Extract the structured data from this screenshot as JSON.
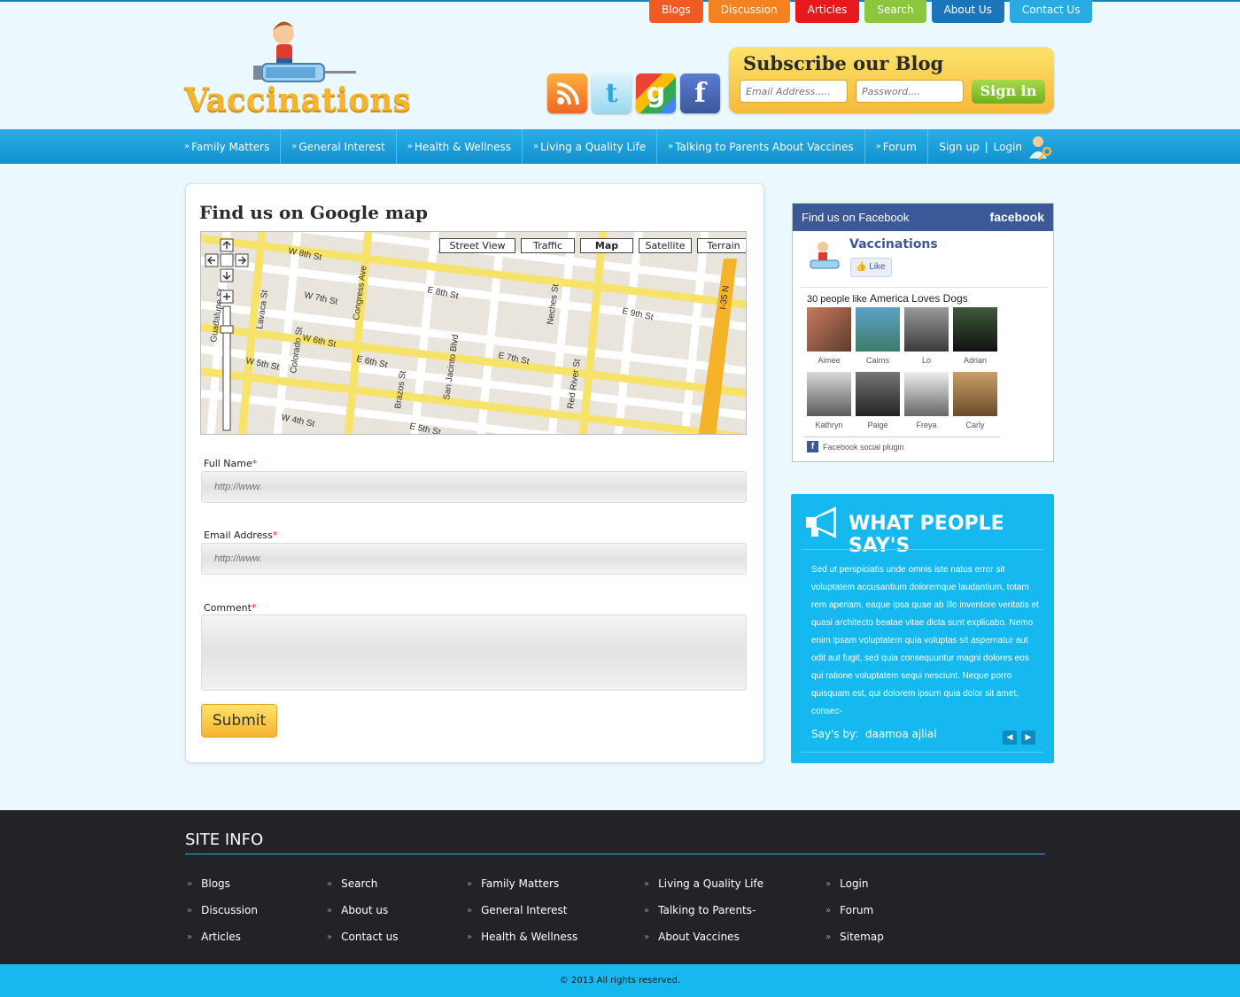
{
  "top_tabs": [
    {
      "label": "Blogs",
      "color": "#f15a24"
    },
    {
      "label": "Discussion",
      "color": "#f58220"
    },
    {
      "label": "Articles",
      "color": "#e8191c"
    },
    {
      "label": "Search",
      "color": "#8cc63f"
    },
    {
      "label": "About Us",
      "color": "#1b75bb"
    },
    {
      "label": "Contact Us",
      "color": "#29abe2"
    }
  ],
  "logo": {
    "text": "Vaccinations"
  },
  "social": [
    {
      "name": "rss",
      "color": "#f7941d"
    },
    {
      "name": "twitter",
      "color": "#48c3ec"
    },
    {
      "name": "google",
      "color": "#34a853"
    },
    {
      "name": "facebook",
      "color": "#3b5998"
    }
  ],
  "subscribe": {
    "title": "Subscribe our Blog",
    "email_placeholder": "Email Address.....",
    "password_placeholder": "Password....",
    "button": "Sign in"
  },
  "nav": {
    "items": [
      "Family Matters",
      "General Interest",
      "Health & Wellness",
      "Living a Quality Life",
      "Talking to Parents About Vaccines",
      "Forum"
    ],
    "signup": "Sign up",
    "separator": "|",
    "login": "Login"
  },
  "main": {
    "title": "Find us on Google map",
    "map_buttons": [
      "Street View",
      "Traffic",
      "Map",
      "Satellite",
      "Terrain"
    ],
    "map_streets": [
      "W 8th St",
      "W 7th St",
      "W 6th St",
      "W 5th St",
      "W 4th St",
      "E 8th St",
      "E 7th St",
      "E 6th St",
      "E 5th St",
      "E 9th St",
      "Congress Ave",
      "Colorado St",
      "Lavaca St",
      "Guadalupe St",
      "Brazos St",
      "San Jacinto Blvd",
      "Red River St",
      "Neches St",
      "I-35 N"
    ],
    "full_name_label": "Full Name",
    "email_label": "Email Address",
    "comment_label": "Comment",
    "required": "*",
    "placeholder": "http://www.",
    "submit": "Submit"
  },
  "facebook": {
    "header": "Find us on Facebook",
    "brand": "facebook",
    "page_name": "Vaccinations",
    "like": "Like",
    "count_text": "30 people like",
    "count_page": "America Loves Dogs",
    "people": [
      "Aimee",
      "Cairns",
      "Lo",
      "Adrian",
      "Kathryn",
      "Paige",
      "Freya",
      "Carly"
    ],
    "plugin": "Facebook social plugin"
  },
  "testimonial": {
    "title": "WHAT PEOPLE SAY'S",
    "text": "Sed ut perspiciatis unde omnis iste natus error sit voluptatem accusantium doloremque laudantium, totam rem aperiam, eaque ipsa quae ab illo inventore veritatis et quasi architecto beatae vitae dicta sunt explicabo. Nemo enim ipsam voluptatem quia voluptas sit aspernatur aut odit aut fugit, sed quia consequuntur magni dolores eos qui ratione voluptatem sequi nesciunt. Neque porro quisquam est, qui dolorem ipsum quia dolor sit amet, consec-",
    "by_label": "Say's by:",
    "by_name": "daamoa ajlial"
  },
  "footer": {
    "title": "SITE INFO",
    "columns": [
      [
        "Blogs",
        "Discussion",
        "Articles"
      ],
      [
        "Search",
        "About us",
        "Contact us"
      ],
      [
        "Family Matters",
        "General Interest",
        "Health & Wellness"
      ],
      [
        "Living a Quality Life",
        "Talking to Parents-",
        "About Vaccines"
      ],
      [
        "Login",
        "Forum",
        "Sitemap"
      ]
    ],
    "copyright": "© 2013 All rights reserved."
  }
}
